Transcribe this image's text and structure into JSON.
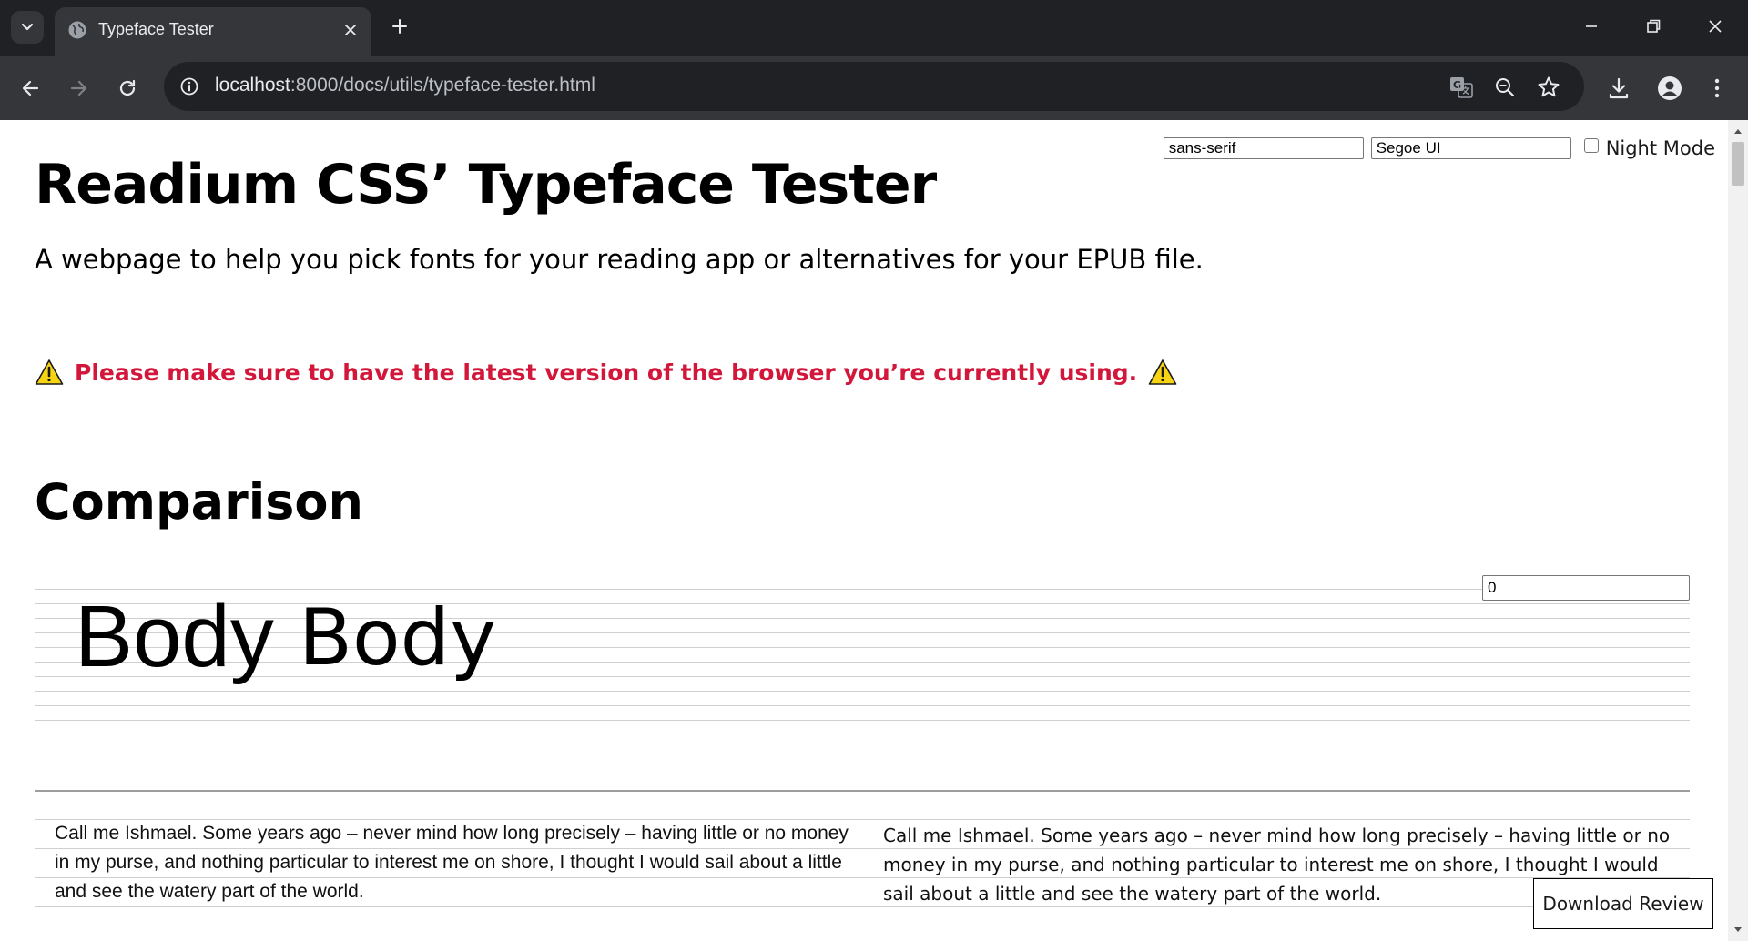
{
  "browser": {
    "tab": {
      "title": "Typeface Tester"
    },
    "address": {
      "host": "localhost",
      "path": ":8000/docs/utils/typeface-tester.html"
    }
  },
  "page": {
    "controls": {
      "generic_family_value": "sans-serif",
      "font_name_value": "Segoe UI",
      "night_mode_label": "Night Mode",
      "night_mode_checked": false
    },
    "title": "Readium CSS’ Typeface Tester",
    "subtitle": "A webpage to help you pick fonts for your reading app or alternatives for your EPUB file.",
    "warning": "Please make sure to have the latest version of the browser you’re currently using.",
    "section_heading": "Comparison",
    "comparison": {
      "offset_value": "0",
      "specimen_left": "Body",
      "specimen_right": "Body"
    },
    "paragraphs": {
      "left": "Call me Ishmael. Some years ago – never mind how long precisely – having little or no money in my purse, and nothing particular to interest me on shore, I thought I would sail about a little and see the watery part of the world.",
      "right": "Call me Ishmael. Some years ago – never mind how long precisely – having little or no money in my purse, and nothing particular to interest me on shore, I thought I would sail about a little and see the watery part of the world."
    },
    "download_label": "Download Review"
  },
  "colors": {
    "warning_text": "#d2173a",
    "chrome_dark": "#202124",
    "chrome_toolbar": "#35363a"
  }
}
